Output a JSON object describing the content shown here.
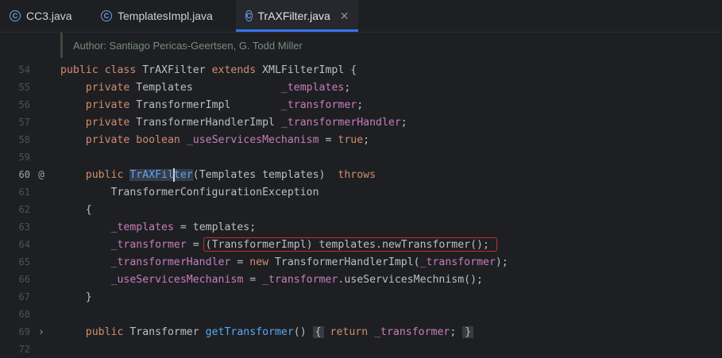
{
  "tabs": [
    {
      "label": "CC3.java",
      "active": false
    },
    {
      "label": "TemplatesImpl.java",
      "active": false
    },
    {
      "label": "TrAXFilter.java",
      "active": true
    }
  ],
  "doc_comment": "Author: Santiago Pericas-Geertsen, G. Todd Miller",
  "lines": [
    {
      "n": "54",
      "text": "public class TrAXFilter extends XMLFilterImpl {"
    },
    {
      "n": "55",
      "text": "    private Templates              _templates;"
    },
    {
      "n": "56",
      "text": "    private TransformerImpl        _transformer;"
    },
    {
      "n": "57",
      "text": "    private TransformerHandlerImpl _transformerHandler;"
    },
    {
      "n": "58",
      "text": "    private boolean _useServicesMechanism = true;"
    },
    {
      "n": "59",
      "text": ""
    },
    {
      "n": "60",
      "text": "    public TrAXFilter(Templates templates)  throws"
    },
    {
      "n": "61",
      "text": "        TransformerConfigurationException"
    },
    {
      "n": "62",
      "text": "    {"
    },
    {
      "n": "63",
      "text": "        _templates = templates;"
    },
    {
      "n": "64",
      "text": "        _transformer = (TransformerImpl) templates.newTransformer();"
    },
    {
      "n": "65",
      "text": "        _transformerHandler = new TransformerHandlerImpl(_transformer);"
    },
    {
      "n": "66",
      "text": "        _useServicesMechanism = _transformer.useServicesMechnism();"
    },
    {
      "n": "67",
      "text": "    }"
    },
    {
      "n": "68",
      "text": ""
    },
    {
      "n": "69",
      "text": "    public Transformer getTransformer() { return _transformer; }"
    },
    {
      "n": "72",
      "text": ""
    }
  ],
  "gutter": {
    "override_marker": "@",
    "fold_marker": "›"
  },
  "colors": {
    "keyword": "#cf8e6d",
    "field": "#c77dbb",
    "method": "#56a8f5",
    "text": "#bcbec4",
    "highlight_box": "#c02f2f",
    "active_tab_underline": "#3574f0"
  }
}
